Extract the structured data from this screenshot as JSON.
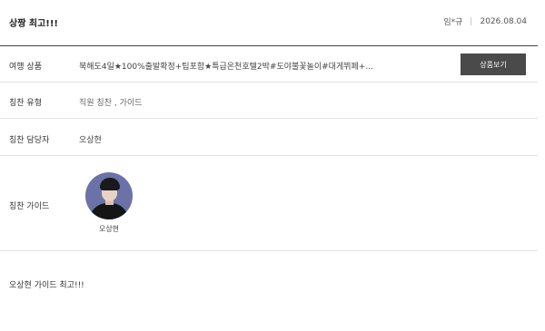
{
  "header": {
    "title": "상짱 최고!!!",
    "author": "임*규",
    "date": "2026.08.04"
  },
  "product": {
    "label": "여행 상품",
    "value": "북해도4일★100%출발확정+팁포함★특급온천호텔2박#도야불꽃놀이#대게뷔페+...",
    "button_label": "상품보기"
  },
  "praise_type": {
    "label": "칭찬 유형",
    "value": "직원 칭찬 , 가이드"
  },
  "praise_manager": {
    "label": "칭찬 담당자",
    "value": "오상현"
  },
  "praise_guide": {
    "label": "칭찬 가이드",
    "name": "오상현",
    "avatar_bg": "#6b72a8"
  },
  "comment": {
    "text": "오상현 가이드 최고!!!"
  },
  "colors": {
    "button_bg": "#4a4a4a",
    "header_border": "#444444",
    "row_border": "#e2e2e2"
  }
}
